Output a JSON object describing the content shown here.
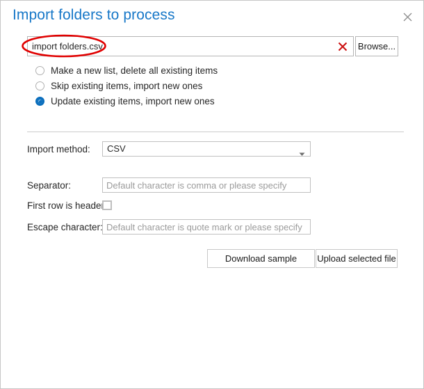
{
  "dialog": {
    "title": "Import folders to process",
    "close_icon": "close-icon"
  },
  "file_row": {
    "filename_value": "import folders.csv",
    "filename_placeholder": "",
    "clear_icon": "clear-x-icon",
    "browse_label": "Browse...",
    "annotation": {
      "shape": "ellipse",
      "color": "#e00000"
    }
  },
  "import_mode": {
    "options": [
      {
        "label": "Make a new list, delete all existing items",
        "selected": false
      },
      {
        "label": "Skip existing items, import new ones",
        "selected": false
      },
      {
        "label": "Update existing items, import new ones",
        "selected": true
      }
    ]
  },
  "form": {
    "import_method": {
      "label": "Import method:",
      "value": "CSV",
      "options": [
        "CSV"
      ],
      "arrow_icon": "chevron-down-icon"
    },
    "separator": {
      "label": "Separator:",
      "value": "",
      "placeholder": "Default character is comma or please specify"
    },
    "first_row_is_header": {
      "label": "First row is header:",
      "checked": false
    },
    "escape_character": {
      "label": "Escape character:",
      "value": "",
      "placeholder": "Default character is quote mark or please specify"
    }
  },
  "actions": {
    "download_sample_label": "Download sample",
    "upload_selected_file_label": "Upload selected file"
  },
  "colors": {
    "title": "#1878c8",
    "accent_radio": "#0a6ebd",
    "annotation_red": "#e00000",
    "clear_red": "#cc1111",
    "border": "#c6c6c6"
  }
}
